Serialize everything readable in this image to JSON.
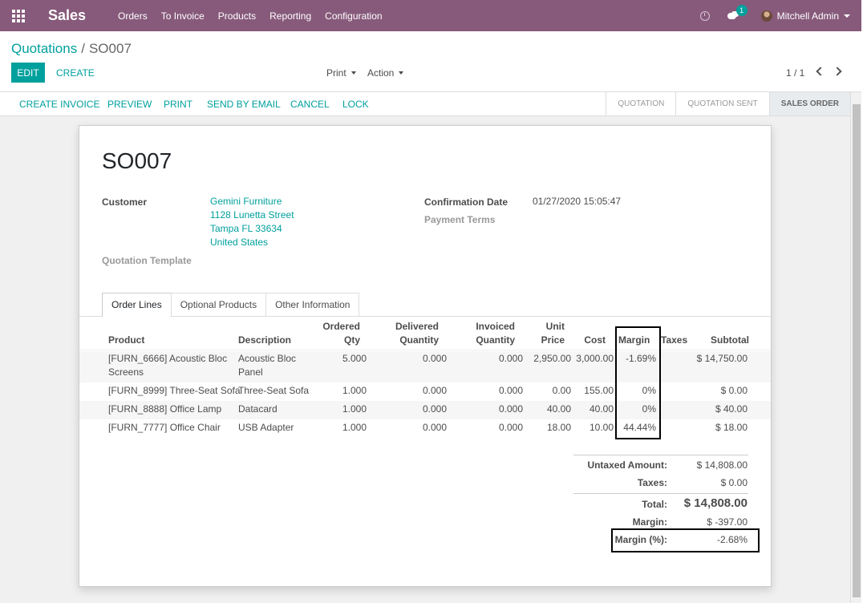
{
  "navbar": {
    "brand": "Sales",
    "menu": [
      "Orders",
      "To Invoice",
      "Products",
      "Reporting",
      "Configuration"
    ],
    "chat_count": "1",
    "user": "Mitchell Admin"
  },
  "breadcrumb": {
    "parent": "Quotations",
    "separator": "/",
    "current": "SO007"
  },
  "buttons": {
    "edit": "EDIT",
    "create": "CREATE",
    "print": "Print",
    "action": "Action"
  },
  "pager": "1 / 1",
  "statusbar": {
    "actions": [
      "CREATE INVOICE",
      "PREVIEW",
      "PRINT",
      "SEND BY EMAIL",
      "CANCEL",
      "LOCK"
    ],
    "stages": [
      "QUOTATION",
      "QUOTATION SENT",
      "SALES ORDER"
    ]
  },
  "form": {
    "name": "SO007",
    "customer_label": "Customer",
    "customer": [
      "Gemini Furniture",
      "1128 Lunetta Street",
      "Tampa FL 33634",
      "United States"
    ],
    "template_label": "Quotation Template",
    "confirmation_label": "Confirmation Date",
    "confirmation_value": "01/27/2020 15:05:47",
    "payment_terms_label": "Payment Terms"
  },
  "tabs": [
    "Order Lines",
    "Optional Products",
    "Other Information"
  ],
  "columns": {
    "product": "Product",
    "description": "Description",
    "ordered_qty": [
      "Ordered",
      "Qty"
    ],
    "delivered_qty": [
      "Delivered",
      "Quantity"
    ],
    "invoiced_qty": [
      "Invoiced",
      "Quantity"
    ],
    "unit_price": [
      "Unit",
      "Price"
    ],
    "cost": "Cost",
    "margin": "Margin",
    "taxes": "Taxes",
    "subtotal": "Subtotal"
  },
  "lines": [
    {
      "product": [
        "[FURN_6666] Acoustic Bloc",
        "Screens"
      ],
      "description": [
        "Acoustic Bloc",
        "Panel"
      ],
      "ordered": "5.000",
      "delivered": "0.000",
      "invoiced": "0.000",
      "price": "2,950.00",
      "cost": "3,000.00",
      "margin": "-1.69%",
      "subtotal": "$ 14,750.00"
    },
    {
      "product": [
        "[FURN_8999] Three-Seat Sofa"
      ],
      "description": [
        "Three-Seat Sofa"
      ],
      "ordered": "1.000",
      "delivered": "0.000",
      "invoiced": "0.000",
      "price": "0.00",
      "cost": "155.00",
      "margin": "0%",
      "subtotal": "$ 0.00"
    },
    {
      "product": [
        "[FURN_8888] Office Lamp"
      ],
      "description": [
        "Datacard"
      ],
      "ordered": "1.000",
      "delivered": "0.000",
      "invoiced": "0.000",
      "price": "40.00",
      "cost": "40.00",
      "margin": "0%",
      "subtotal": "$ 40.00"
    },
    {
      "product": [
        "[FURN_7777] Office Chair"
      ],
      "description": [
        "USB Adapter"
      ],
      "ordered": "1.000",
      "delivered": "0.000",
      "invoiced": "0.000",
      "price": "18.00",
      "cost": "10.00",
      "margin": "44.44%",
      "subtotal": "$ 18.00"
    }
  ],
  "totals": {
    "untaxed_label": "Untaxed Amount:",
    "untaxed": "$ 14,808.00",
    "taxes_label": "Taxes:",
    "taxes": "$ 0.00",
    "total_label": "Total:",
    "total": "$ 14,808.00",
    "margin_label": "Margin:",
    "margin": "$ -397.00",
    "margin_pct_label": "Margin (%):",
    "margin_pct": "-2.68%"
  },
  "colors": {
    "brand": "#875a7b",
    "accent": "#00a09d"
  }
}
